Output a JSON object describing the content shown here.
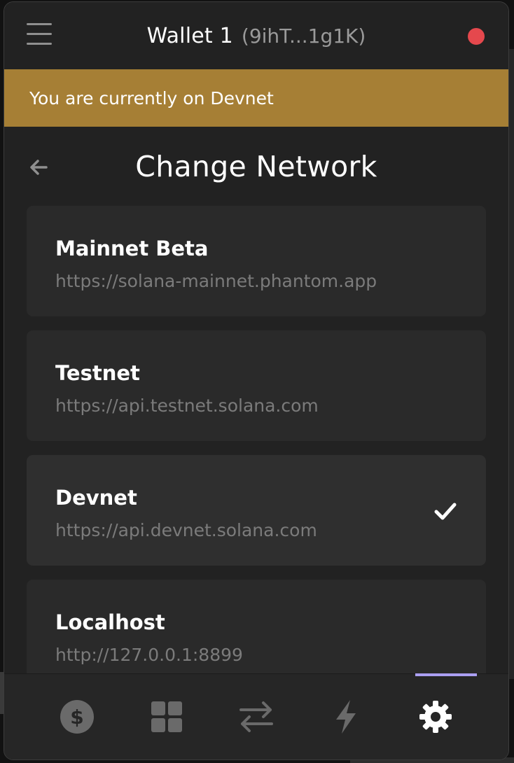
{
  "header": {
    "wallet_name": "Wallet 1",
    "wallet_address": "(9ihT...1g1K)",
    "status_color": "#e5484d"
  },
  "banner": {
    "text": "You are currently on Devnet",
    "color": "#a67f35"
  },
  "page": {
    "title": "Change Network"
  },
  "networks": [
    {
      "name": "Mainnet Beta",
      "url": "https://solana-mainnet.phantom.app",
      "selected": false
    },
    {
      "name": "Testnet",
      "url": "https://api.testnet.solana.com",
      "selected": false
    },
    {
      "name": "Devnet",
      "url": "https://api.devnet.solana.com",
      "selected": true
    },
    {
      "name": "Localhost",
      "url": "http://127.0.0.1:8899",
      "selected": false
    }
  ],
  "tabbar": {
    "tabs": [
      {
        "icon": "dollar-icon",
        "active": false
      },
      {
        "icon": "grid-icon",
        "active": false
      },
      {
        "icon": "swap-icon",
        "active": false
      },
      {
        "icon": "lightning-icon",
        "active": false
      },
      {
        "icon": "gear-icon",
        "active": true
      }
    ],
    "accent_color": "#ab9ff2"
  }
}
